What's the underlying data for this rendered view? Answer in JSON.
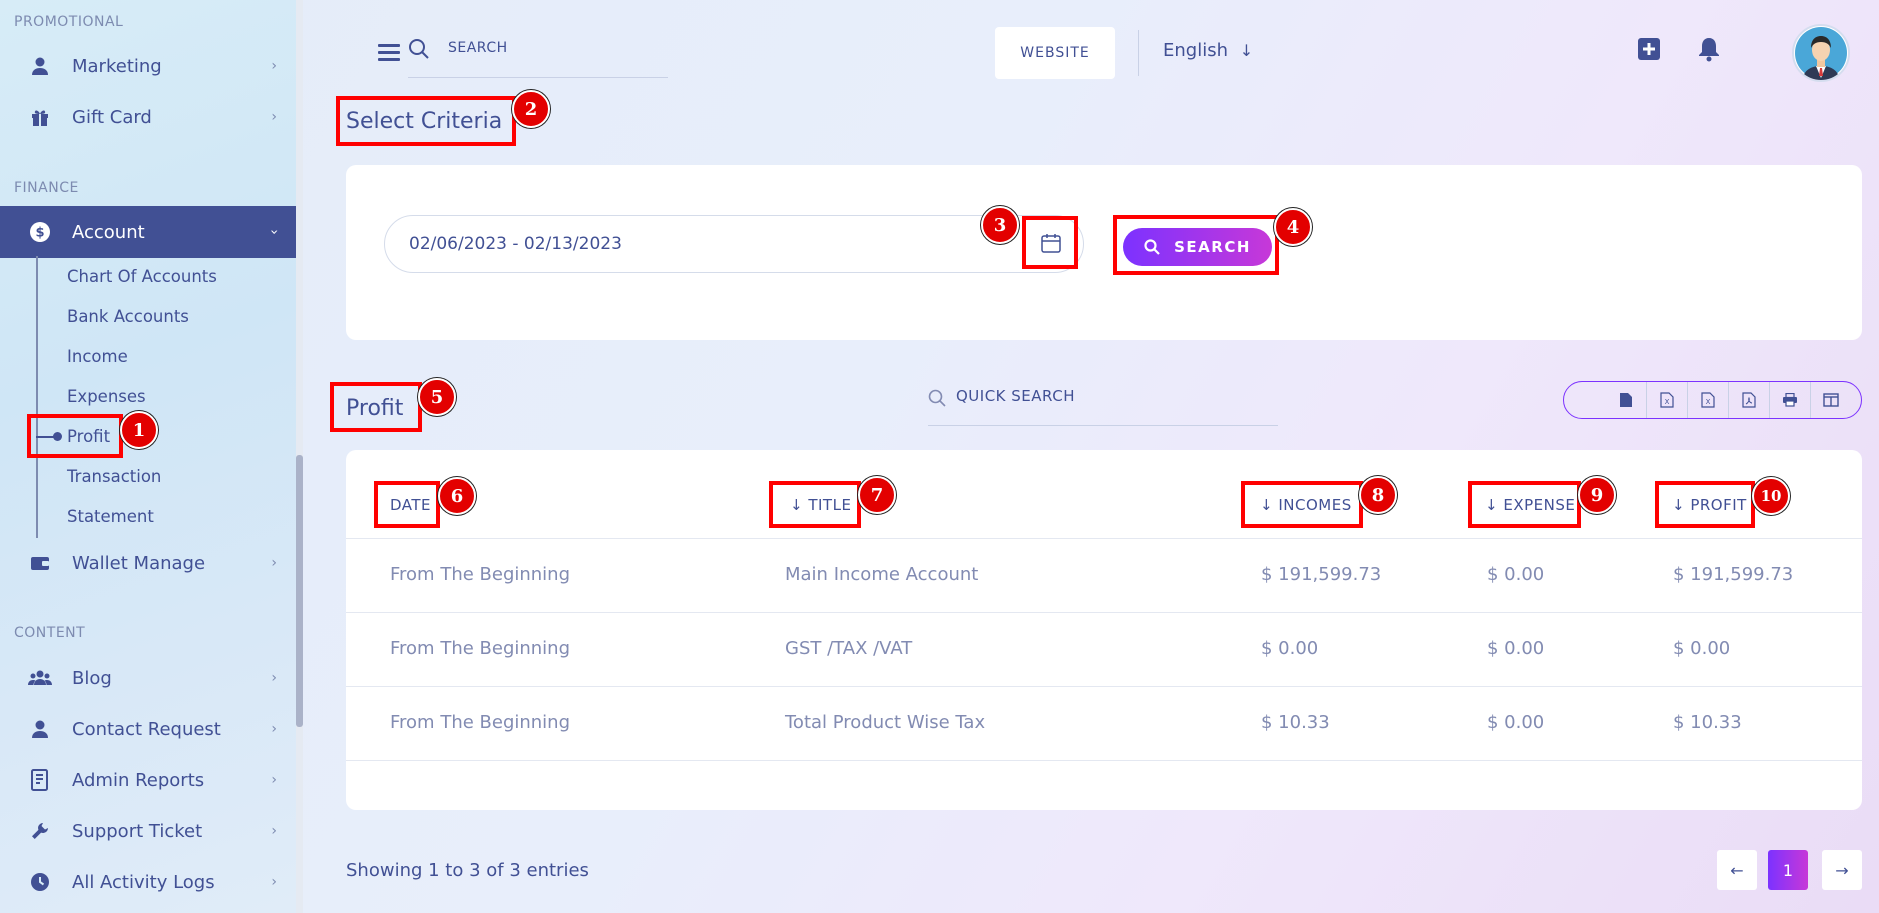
{
  "sidebar": {
    "sections": {
      "promotional": "PROMOTIONAL",
      "finance": "FINANCE",
      "content": "CONTENT"
    },
    "items": {
      "marketing": "Marketing",
      "gift_card": "Gift Card",
      "account": "Account",
      "wallet_manage": "Wallet Manage",
      "blog": "Blog",
      "contact_request": "Contact Request",
      "admin_reports": "Admin Reports",
      "support_ticket": "Support Ticket",
      "all_activity_logs": "All Activity Logs"
    },
    "account_subitems": {
      "chart_of_accounts": "Chart Of Accounts",
      "bank_accounts": "Bank Accounts",
      "income": "Income",
      "expenses": "Expenses",
      "profit": "Profit",
      "transaction": "Transaction",
      "statement": "Statement"
    }
  },
  "topbar": {
    "search_placeholder": "SEARCH",
    "website_label": "WEBSITE",
    "language": "English"
  },
  "criteria": {
    "title": "Select Criteria",
    "date_range": "02/06/2023 - 02/13/2023",
    "search_label": "SEARCH"
  },
  "profit": {
    "title": "Profit",
    "quick_search_placeholder": "QUICK SEARCH",
    "columns": {
      "date": "DATE",
      "title": "TITLE",
      "incomes": "INCOMES",
      "expense": "EXPENSE",
      "profit": "PROFIT"
    },
    "rows": [
      {
        "date": "From The Beginning",
        "title": "Main Income Account",
        "incomes": "$ 191,599.73",
        "expense": "$ 0.00",
        "profit": "$ 191,599.73"
      },
      {
        "date": "From The Beginning",
        "title": "GST /TAX /VAT",
        "incomes": "$ 0.00",
        "expense": "$ 0.00",
        "profit": "$ 0.00"
      },
      {
        "date": "From The Beginning",
        "title": "Total Product Wise Tax",
        "incomes": "$ 10.33",
        "expense": "$ 0.00",
        "profit": "$ 10.33"
      }
    ],
    "showing": "Showing 1 to 3 of 3 entries",
    "current_page": "1"
  },
  "annotations": [
    "1",
    "2",
    "3",
    "4",
    "5",
    "6",
    "7",
    "8",
    "9",
    "10"
  ],
  "colors": {
    "primary": "#415094",
    "accent_start": "#7c32ff",
    "accent_end": "#c738d8",
    "annotation": "#ff0000"
  }
}
